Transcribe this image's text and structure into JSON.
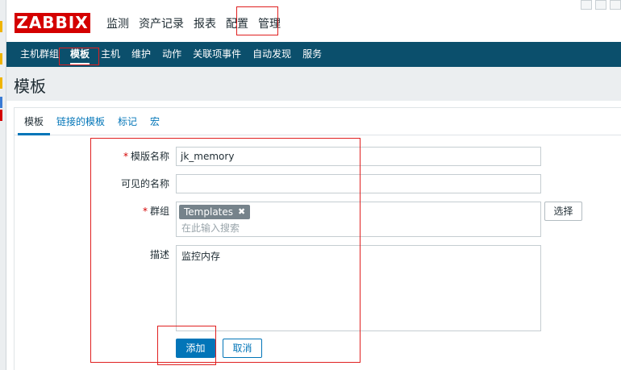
{
  "app": {
    "logo": "ZABBIX"
  },
  "main_menu": [
    {
      "label": "监测"
    },
    {
      "label": "资产记录"
    },
    {
      "label": "报表"
    },
    {
      "label": "配置"
    },
    {
      "label": "管理"
    }
  ],
  "main_menu_active": "配置",
  "sub_menu": [
    {
      "label": "主机群组"
    },
    {
      "label": "模板"
    },
    {
      "label": "主机"
    },
    {
      "label": "维护"
    },
    {
      "label": "动作"
    },
    {
      "label": "关联项事件"
    },
    {
      "label": "自动发现"
    },
    {
      "label": "服务"
    }
  ],
  "sub_menu_active": "模板",
  "page": {
    "title": "模板"
  },
  "tabs": [
    {
      "label": "模板"
    },
    {
      "label": "链接的模板"
    },
    {
      "label": "标记"
    },
    {
      "label": "宏"
    }
  ],
  "form": {
    "required_mark": "*",
    "template_name": {
      "label": "模版名称",
      "value": "jk_memory"
    },
    "visible_name": {
      "label": "可见的名称",
      "value": ""
    },
    "groups": {
      "label": "群组",
      "chip": "Templates",
      "chip_remove": "✖",
      "placeholder": "在此输入搜索",
      "select_button": "选择"
    },
    "description": {
      "label": "描述",
      "value": "监控内存"
    },
    "add_button": "添加",
    "cancel_button": "取消"
  },
  "colors": {
    "brand_red": "#d40000",
    "nav_blue": "#0b4f6c",
    "accent": "#0275b8",
    "highlight_box": "#e02020"
  }
}
